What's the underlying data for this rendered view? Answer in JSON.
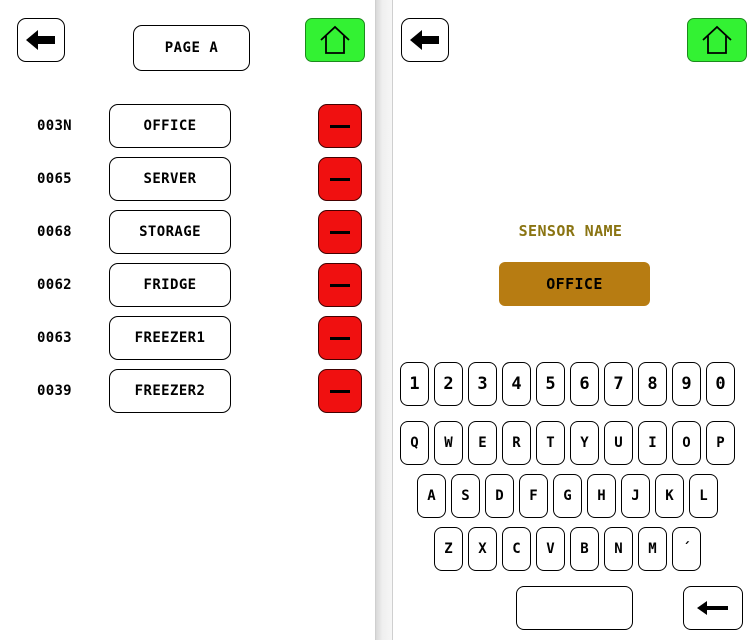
{
  "left_screen": {
    "page_button_label": "PAGE A",
    "back_icon": "left-arrow-icon",
    "home_icon": "house-outline-icon",
    "home_color": "#33f233",
    "delete_color": "#f01010",
    "rows": [
      {
        "id": "003N",
        "name": "OFFICE"
      },
      {
        "id": "0065",
        "name": "SERVER"
      },
      {
        "id": "0068",
        "name": "STORAGE"
      },
      {
        "id": "0062",
        "name": "FRIDGE"
      },
      {
        "id": "0063",
        "name": "FREEZER1"
      },
      {
        "id": "0039",
        "name": "FREEZER2"
      }
    ]
  },
  "right_screen": {
    "back_icon": "left-arrow-icon",
    "home_icon": "house-outline-icon",
    "sensor_label": "SENSOR NAME",
    "sensor_value": "OFFICE",
    "sensor_value_color": "#b77c12",
    "keyboard": {
      "row1": [
        "1",
        "2",
        "3",
        "4",
        "5",
        "6",
        "7",
        "8",
        "9",
        "0"
      ],
      "row2": [
        "Q",
        "W",
        "E",
        "R",
        "T",
        "Y",
        "U",
        "I",
        "O",
        "P"
      ],
      "row3": [
        "A",
        "S",
        "D",
        "F",
        "G",
        "H",
        "J",
        "K",
        "L"
      ],
      "row4": [
        "Z",
        "X",
        "C",
        "V",
        "B",
        "N",
        "M",
        "´"
      ],
      "space_label": "",
      "enter_icon": "left-arrow-icon"
    }
  }
}
